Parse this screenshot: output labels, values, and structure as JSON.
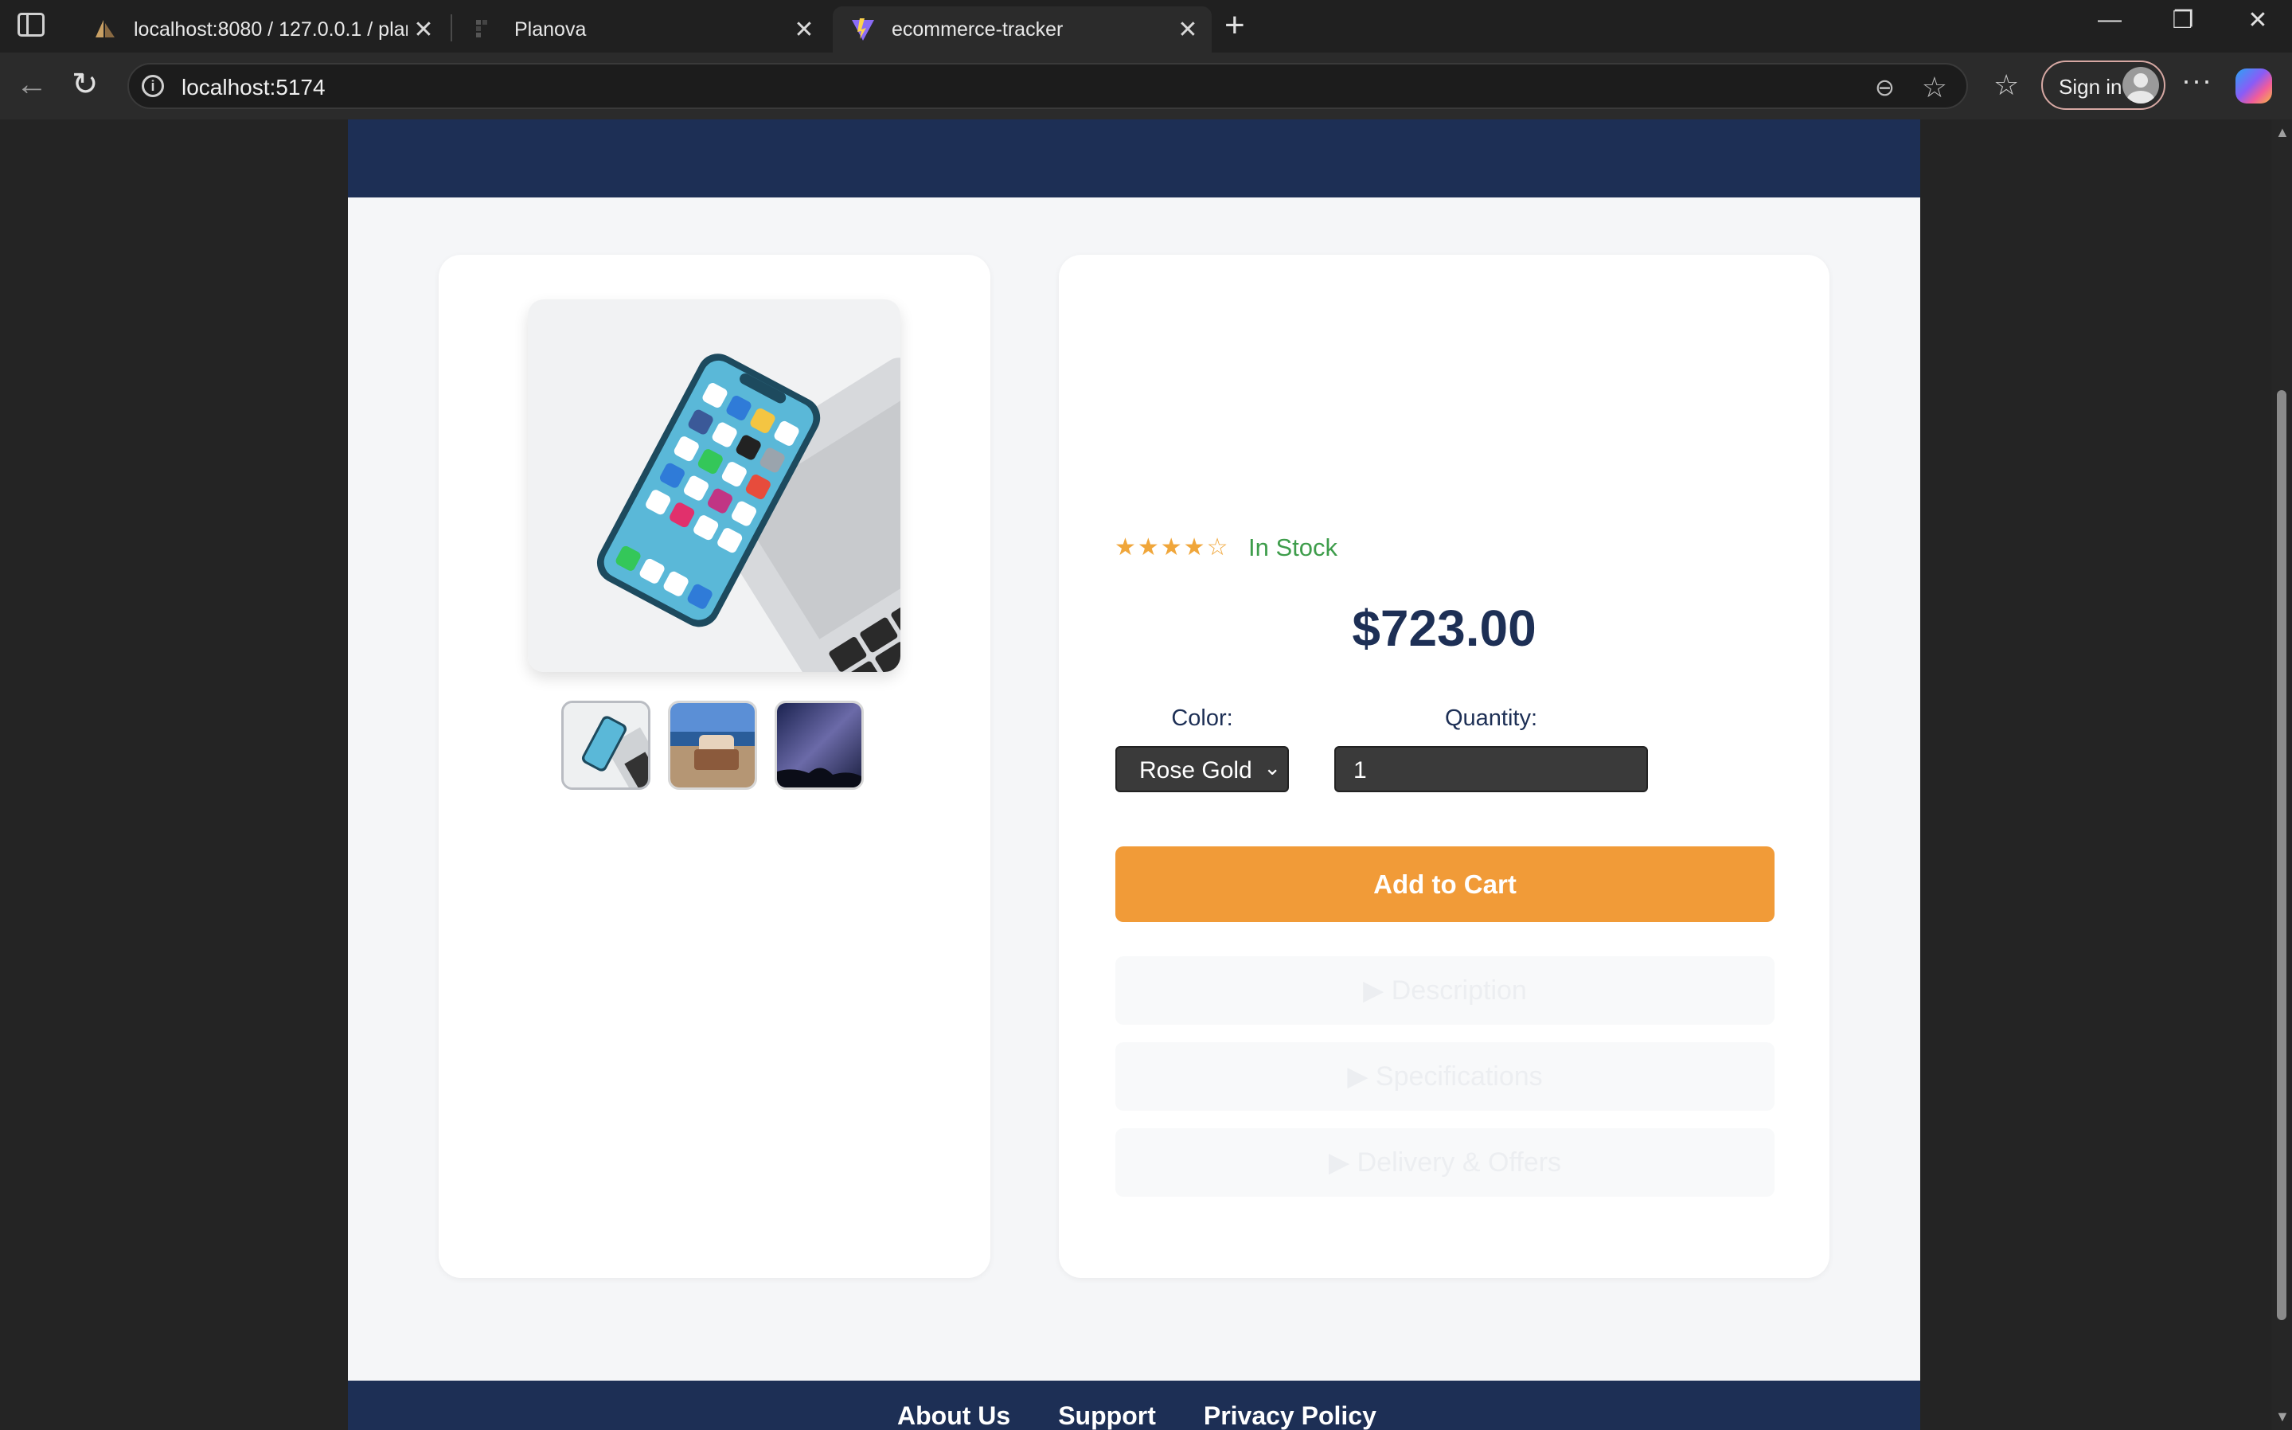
{
  "browser": {
    "tabs": [
      {
        "title": "localhost:8080 / 127.0.0.1 / planova",
        "active": false
      },
      {
        "title": "Planova",
        "active": false
      },
      {
        "title": "ecommerce-tracker",
        "active": true
      }
    ],
    "url": "localhost:5174",
    "sign_in_label": "Sign in",
    "icons": [
      "sidebar-icon",
      "back-icon",
      "reload-icon",
      "info-icon",
      "zoom-out-icon",
      "star-icon",
      "favorites-icon",
      "more-icon",
      "copilot-icon"
    ]
  },
  "product": {
    "rating_stars": "★★★★☆",
    "rating_value": 4,
    "rating_max": 5,
    "stock_status": "In Stock",
    "price": "$723.00",
    "color_label": "Color:",
    "color_selected": "Rose Gold",
    "quantity_label": "Quantity:",
    "quantity_value": "1",
    "add_to_cart_label": "Add to Cart",
    "thumbnails": [
      "phone-thumbnail",
      "beach-chair-thumbnail",
      "night-sky-thumbnail"
    ],
    "accordions": [
      {
        "label": "▶ Description"
      },
      {
        "label": "▶ Specifications"
      },
      {
        "label": "▶ Delivery & Offers"
      }
    ]
  },
  "footer": {
    "links": [
      "About Us",
      "Support",
      "Privacy Policy"
    ]
  },
  "colors": {
    "header_navy": "#1d2f55",
    "accent_orange": "#f19b38",
    "stock_green": "#3e9d4b",
    "star_orange": "#f0a63a"
  }
}
